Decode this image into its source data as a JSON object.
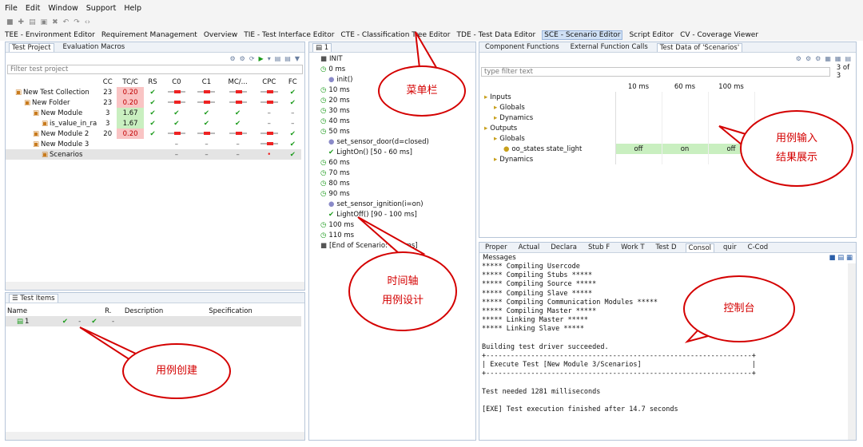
{
  "menu": [
    "File",
    "Edit",
    "Window",
    "Support",
    "Help"
  ],
  "editors": [
    {
      "label": "TEE - Environment Editor",
      "selected": false
    },
    {
      "label": "Requirement Management",
      "selected": false
    },
    {
      "label": "Overview",
      "selected": false
    },
    {
      "label": "TIE - Test Interface Editor",
      "selected": false
    },
    {
      "label": "CTE - Classification Tree Editor",
      "selected": false
    },
    {
      "label": "TDE - Test Data Editor",
      "selected": false
    },
    {
      "label": "SCE - Scenario Editor",
      "selected": true
    },
    {
      "label": "Script Editor",
      "selected": false
    },
    {
      "label": "CV - Coverage Viewer",
      "selected": false
    }
  ],
  "project": {
    "tabs": [
      "Test Project",
      "Evaluation Macros"
    ],
    "filter_placeholder": "Filter test project",
    "columns": [
      "",
      "CC",
      "TC/C",
      "RS",
      "C0",
      "C1",
      "MC/...",
      "CPC",
      "FC"
    ],
    "rows": [
      {
        "name": "New Test Collection",
        "cc": "23",
        "tcc": "0.20",
        "tcc_style": "red",
        "rs": "✔",
        "c0": "bar",
        "c1": "bar",
        "mc": "bar",
        "cpc": "bar",
        "fc": "✔",
        "indent": 0
      },
      {
        "name": "New Folder",
        "cc": "23",
        "tcc": "0.20",
        "tcc_style": "red",
        "rs": "✔",
        "c0": "bar",
        "c1": "bar",
        "mc": "bar",
        "cpc": "bar",
        "fc": "✔",
        "indent": 1
      },
      {
        "name": "New Module",
        "cc": "3",
        "tcc": "1.67",
        "tcc_style": "grn",
        "rs": "✔",
        "c0": "✔",
        "c1": "✔",
        "mc": "✔",
        "cpc": "–",
        "fc": "–",
        "indent": 2
      },
      {
        "name": "is_value_in_ra",
        "cc": "3",
        "tcc": "1.67",
        "tcc_style": "grn",
        "rs": "✔",
        "c0": "✔",
        "c1": "✔",
        "mc": "✔",
        "cpc": "–",
        "fc": "–",
        "indent": 3
      },
      {
        "name": "New Module 2",
        "cc": "20",
        "tcc": "0.20",
        "tcc_style": "red",
        "rs": "✔",
        "c0": "bar",
        "c1": "bar",
        "mc": "bar",
        "cpc": "bar",
        "fc": "✔",
        "indent": 2
      },
      {
        "name": "New Module 3",
        "cc": "",
        "tcc": "",
        "tcc_style": "",
        "rs": "",
        "c0": "–",
        "c1": "–",
        "mc": "–",
        "cpc": "bar",
        "fc": "✔",
        "indent": 2
      },
      {
        "name": "Scenarios",
        "cc": "",
        "tcc": "",
        "tcc_style": "",
        "rs": "",
        "c0": "–",
        "c1": "–",
        "mc": "–",
        "cpc": "•",
        "fc": "✔",
        "indent": 3,
        "selected": true
      }
    ]
  },
  "test_items": {
    "tab": "Test Items",
    "columns": [
      "Name",
      "",
      "",
      "",
      "R.",
      "Description",
      "Specification"
    ],
    "rows": [
      {
        "name": "1",
        "c1": "✔",
        "c2": "-",
        "c3": "✔",
        "c4": "-"
      }
    ]
  },
  "timeline": {
    "tab": "1",
    "items": [
      {
        "text": "INIT",
        "kind": "square",
        "indent": 0
      },
      {
        "text": "0 ms",
        "kind": "clock",
        "indent": 0
      },
      {
        "text": "init()",
        "kind": "dot",
        "indent": 1
      },
      {
        "text": "10 ms",
        "kind": "clock",
        "indent": 0
      },
      {
        "text": "20 ms",
        "kind": "clock",
        "indent": 0
      },
      {
        "text": "30 ms",
        "kind": "clock",
        "indent": 0
      },
      {
        "text": "40 ms",
        "kind": "clock",
        "indent": 0
      },
      {
        "text": "50 ms",
        "kind": "clock",
        "indent": 0
      },
      {
        "text": "set_sensor_door(d=closed)",
        "kind": "dot",
        "indent": 1
      },
      {
        "text": "LightOn() [50 - 60 ms]",
        "kind": "check",
        "indent": 1
      },
      {
        "text": "60 ms",
        "kind": "clock",
        "indent": 0
      },
      {
        "text": "70 ms",
        "kind": "clock",
        "indent": 0
      },
      {
        "text": "80 ms",
        "kind": "clock",
        "indent": 0
      },
      {
        "text": "90 ms",
        "kind": "clock",
        "indent": 0
      },
      {
        "text": "set_sensor_ignition(i=on)",
        "kind": "dot",
        "indent": 1
      },
      {
        "text": "LightOff() [90 - 100 ms]",
        "kind": "check",
        "indent": 1
      },
      {
        "text": "100 ms",
        "kind": "clock",
        "indent": 0
      },
      {
        "text": "110 ms",
        "kind": "clock",
        "indent": 0
      },
      {
        "text": "[End of Scenario: 110 ms]",
        "kind": "square",
        "indent": 0
      }
    ]
  },
  "testdata": {
    "tabs": [
      "Component Functions",
      "External Function Calls",
      "Test Data of 'Scenarios'"
    ],
    "filter_placeholder": "type filter text",
    "page": "3 of 3",
    "times": [
      "10 ms",
      "60 ms",
      "100 ms"
    ],
    "tree": [
      {
        "text": "Inputs",
        "indent": 0
      },
      {
        "text": "Globals",
        "indent": 1
      },
      {
        "text": "Dynamics",
        "indent": 1
      },
      {
        "text": "Outputs",
        "indent": 0
      },
      {
        "text": "Globals",
        "indent": 1
      },
      {
        "text": "oo_states state_light",
        "indent": 2,
        "values": [
          "off",
          "on",
          "off"
        ]
      },
      {
        "text": "Dynamics",
        "indent": 1
      }
    ]
  },
  "console": {
    "tabs": [
      "Proper",
      "Actual",
      "Declara",
      "Stub F",
      "Work T",
      "Test D",
      "Consol",
      "quir",
      "C-Cod"
    ],
    "label": "Messages",
    "lines": [
      "***** Compiling Usercode",
      "***** Compiling Stubs *****",
      "***** Compiling Source *****",
      "***** Compiling Slave *****",
      "***** Compiling Communication Modules *****",
      "***** Compiling Master *****",
      "***** Linking Master *****",
      "***** Linking Slave *****",
      "",
      "Building test driver succeeded.",
      "+-----------------------------------------------------------------+",
      "| Execute Test [New Module 3/Scenarios]                           |",
      "+-----------------------------------------------------------------+",
      "",
      "Test needed 1281 milliseconds",
      "",
      "[EXE] Test execution finished after 14.7 seconds"
    ]
  },
  "annotations": {
    "menubar": "菜单栏",
    "io": [
      "用例输入",
      "结果展示"
    ],
    "timeline": [
      "时间轴",
      "用例设计"
    ],
    "console": "控制台",
    "create": "用例创建"
  },
  "colors": {
    "accent": "#d40000",
    "selection": "#cfe0f5"
  }
}
